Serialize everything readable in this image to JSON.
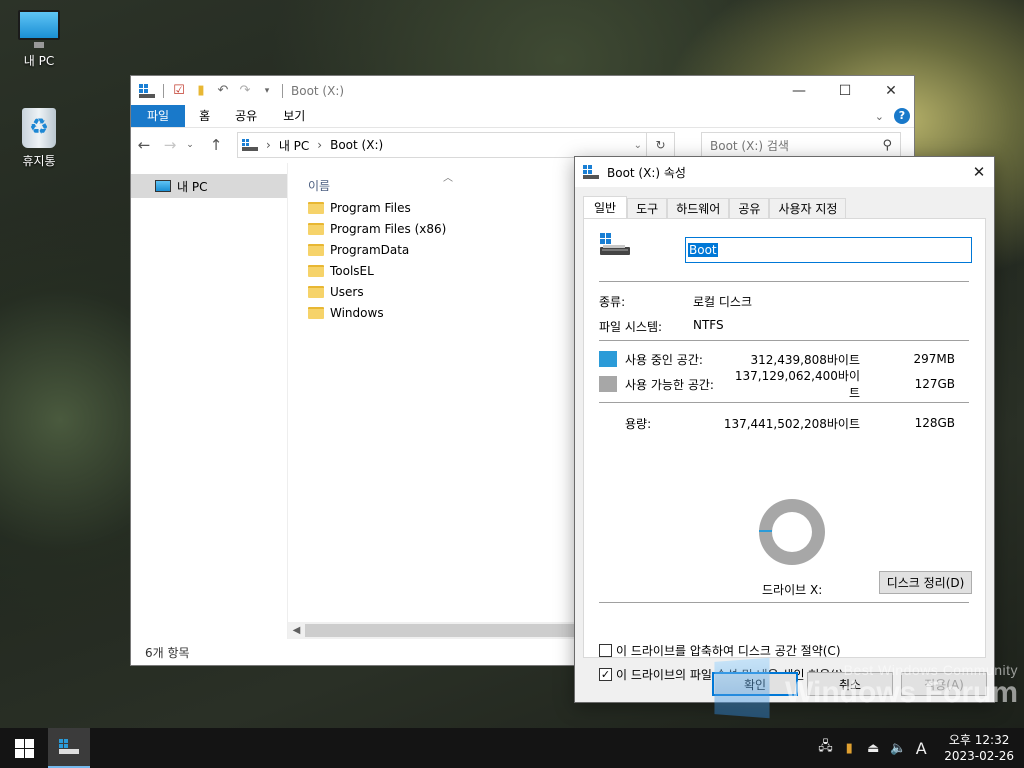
{
  "desktop": {
    "icons": [
      {
        "label": "내 PC",
        "icon": "monitor-icon"
      },
      {
        "label": "휴지통",
        "icon": "recycle-bin-icon"
      }
    ]
  },
  "explorer": {
    "title": "Boot (X:)",
    "ribbon_tabs": [
      "파일",
      "홈",
      "공유",
      "보기"
    ],
    "breadcrumb": [
      "내 PC",
      "Boot (X:)"
    ],
    "search_placeholder": "Boot (X:) 검색",
    "nav_pane": {
      "item": "내 PC"
    },
    "column_header": "이름",
    "files": [
      "Program Files",
      "Program Files (x86)",
      "ProgramData",
      "ToolsEL",
      "Users",
      "Windows"
    ],
    "status": "6개 항목",
    "colors": {
      "accent": "#1979ca",
      "folder": "#f6d36a"
    }
  },
  "properties": {
    "title": "Boot (X:) 속성",
    "tabs": [
      "일반",
      "도구",
      "하드웨어",
      "공유",
      "사용자 지정"
    ],
    "name_value": "Boot",
    "type_label": "종류:",
    "type_value": "로컬 디스크",
    "fs_label": "파일 시스템:",
    "fs_value": "NTFS",
    "used": {
      "label": "사용 중인 공간:",
      "bytes": "312,439,808바이트",
      "size": "297MB",
      "color": "#2b9bd8"
    },
    "free": {
      "label": "사용 가능한 공간:",
      "bytes": "137,129,062,400바이트",
      "size": "127GB",
      "color": "#a7a7a7"
    },
    "capacity": {
      "label": "용량:",
      "bytes": "137,441,502,208바이트",
      "size": "128GB"
    },
    "used_fraction": 0.0023,
    "drive_label": "드라이브 X:",
    "cleanup_button": "디스크 정리(D)",
    "compress_label": "이 드라이브를 압축하여 디스크 공간 절약(C)",
    "compress_checked": false,
    "index_label": "이 드라이브의 파일 속성 및 내용 색인 허용(I)",
    "index_checked": true,
    "buttons": {
      "ok": "확인",
      "cancel": "취소",
      "apply": "적용(A)"
    }
  },
  "watermark": {
    "line1": "Best Windows Community",
    "line2": "Windows Forum"
  },
  "taskbar": {
    "ampm_time": "오후 12:32",
    "date": "2023-02-26",
    "ime": "A"
  }
}
